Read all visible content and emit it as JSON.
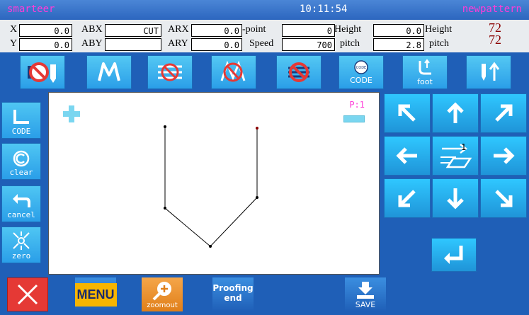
{
  "title": {
    "left": "smarteer",
    "time": "10:11:54",
    "right": "newpattern"
  },
  "status": {
    "x_label": "X",
    "x_val": "0.0",
    "y_label": "Y",
    "y_val": "0.0",
    "abx_label": "ABX",
    "abx_val": "CUT",
    "aby_label": "ABY",
    "aby_val": "",
    "arx_label": "ARX",
    "arx_val": "0.0",
    "ary_label": "ARY",
    "ary_val": "0.0",
    "point_label": "-point",
    "point_val": "0",
    "speed_label": "Speed",
    "speed_val": "700",
    "height_label": "Height",
    "height_val": "0.0",
    "pitch_label": "pitch",
    "pitch_val": "2.8",
    "height2_label": "Height",
    "height2_val": "72",
    "pitch2_label": "pitch",
    "pitch2_val": "72"
  },
  "toolbar": {
    "code_label": "CODE",
    "foot_label": "foot"
  },
  "left": {
    "code": "CODE",
    "clear": "clear",
    "cancel": "cancel",
    "zero": "zero"
  },
  "canvas": {
    "pcount": "P:1"
  },
  "arrows": {
    "center_badge": "1"
  },
  "bottom": {
    "menu": "MENU",
    "zoomout": "zoomout",
    "proofing": "Proofing",
    "proofing_end": "end",
    "save": "SAVE"
  },
  "colors": {
    "accent": "#2a9ee8",
    "pink": "#ff3bd8",
    "close_red": "#e53935"
  }
}
